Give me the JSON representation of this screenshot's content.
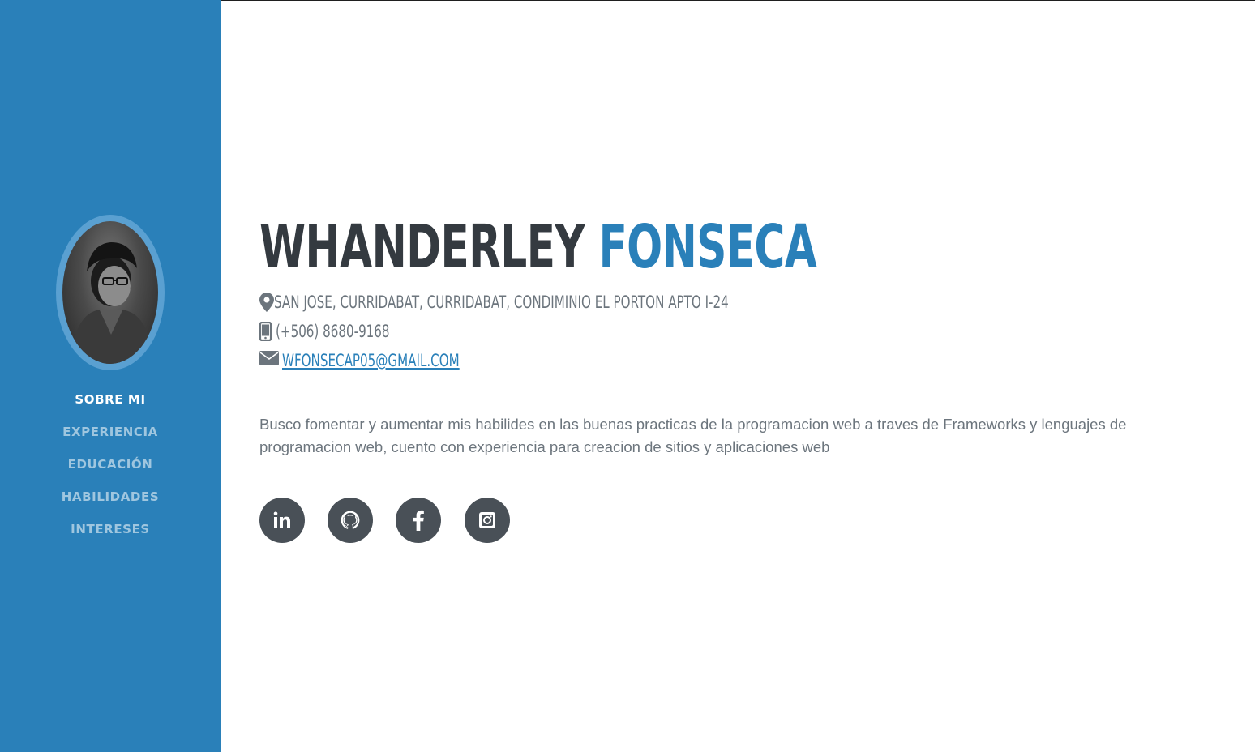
{
  "sidebar": {
    "avatar_alt": "profile photo",
    "nav": [
      {
        "label": "SOBRE MI",
        "active": true
      },
      {
        "label": "EXPERIENCIA",
        "active": false
      },
      {
        "label": "EDUCACIÓN",
        "active": false
      },
      {
        "label": "HABILIDADES",
        "active": false
      },
      {
        "label": "INTERESES",
        "active": false
      }
    ]
  },
  "profile": {
    "first_name": "WHANDERLEY",
    "last_name": "FONSECA",
    "address": "SAN JOSE, CURRIDABAT, CURRIDABAT, CONDIMINIO EL PORTON APTO I-24",
    "phone": "(+506) 8680-9168",
    "email": "WFONSECAP05@GMAIL.COM",
    "summary": "Busco fomentar y aumentar mis habilides en las buenas practicas de la programacion web a traves de Frameworks y lenguajes de programacion web, cuento con experiencia para creacion de sitios y aplicaciones web"
  },
  "socials": [
    {
      "icon": "linkedin-icon"
    },
    {
      "icon": "github-icon"
    },
    {
      "icon": "facebook-icon"
    },
    {
      "icon": "instagram-icon"
    }
  ],
  "colors": {
    "sidebar_bg": "#2a80b9",
    "accent": "#2a80b9",
    "heading": "#343a40",
    "muted_text": "#6c757d",
    "social_bg": "#495057"
  }
}
